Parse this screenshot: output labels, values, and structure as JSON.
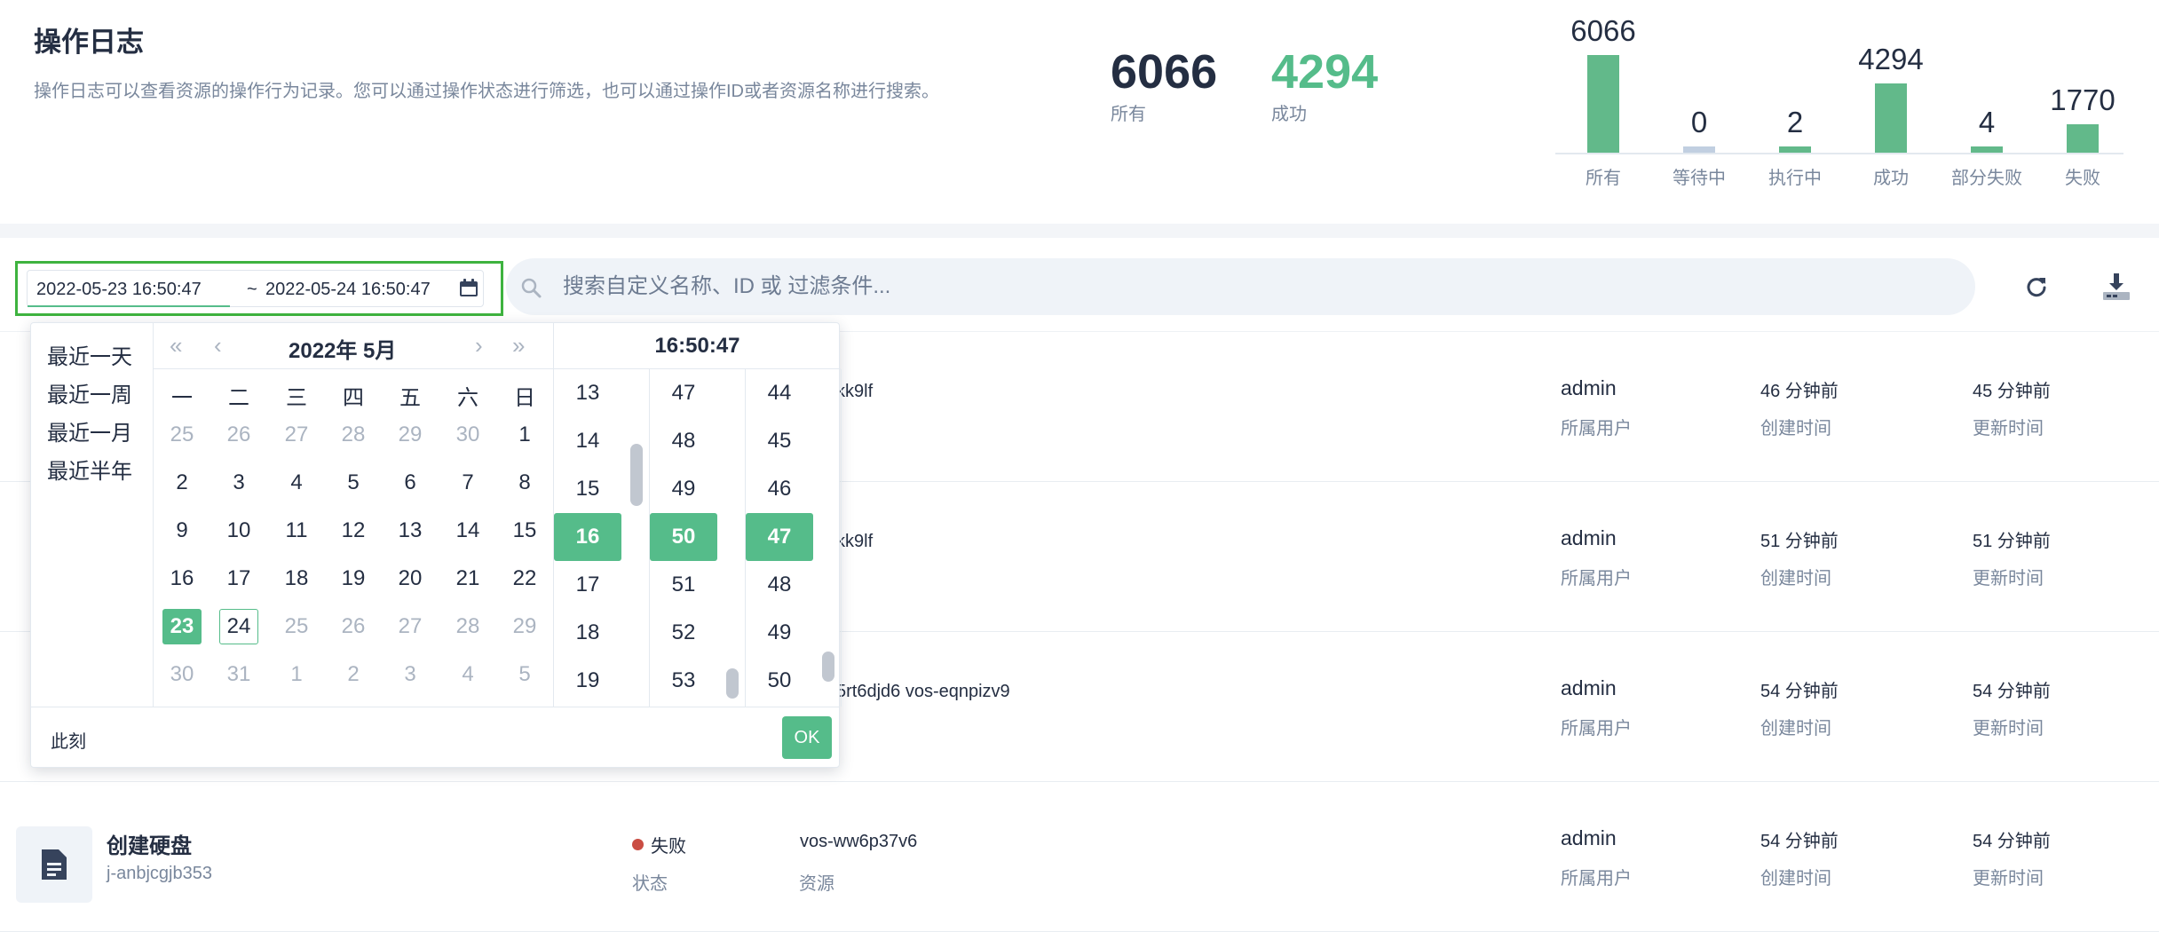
{
  "header": {
    "title": "操作日志",
    "description": "操作日志可以查看资源的操作行为记录。您可以通过操作状态进行筛选，也可以通过操作ID或者资源名称进行搜索。"
  },
  "stats": {
    "all": {
      "value": "6066",
      "label": "所有"
    },
    "success": {
      "value": "4294",
      "label": "成功"
    }
  },
  "chart_data": {
    "type": "bar",
    "categories": [
      "所有",
      "等待中",
      "执行中",
      "成功",
      "部分失败",
      "失败"
    ],
    "values": [
      6066,
      0,
      2,
      4294,
      4,
      1770
    ],
    "title": "",
    "xlabel": "",
    "ylabel": "",
    "colors": {
      "bar": "#62b98a",
      "zero_bar": "#c1cfe1"
    }
  },
  "toolbar": {
    "date_start": "2022-05-23 16:50:47",
    "date_sep": "~",
    "date_end": "2022-05-24 16:50:47",
    "search_placeholder": "搜索自定义名称、ID 或 过滤条件..."
  },
  "picker": {
    "shortcuts": [
      "最近一天",
      "最近一周",
      "最近一月",
      "最近半年"
    ],
    "title": "2022年  5月",
    "weekdays": [
      "一",
      "二",
      "三",
      "四",
      "五",
      "六",
      "日"
    ],
    "weeks": [
      [
        [
          "25",
          "o"
        ],
        [
          "26",
          "o"
        ],
        [
          "27",
          "o"
        ],
        [
          "28",
          "o"
        ],
        [
          "29",
          "o"
        ],
        [
          "30",
          "o"
        ],
        [
          "1",
          "c"
        ]
      ],
      [
        [
          "2",
          "c"
        ],
        [
          "3",
          "c"
        ],
        [
          "4",
          "c"
        ],
        [
          "5",
          "c"
        ],
        [
          "6",
          "c"
        ],
        [
          "7",
          "c"
        ],
        [
          "8",
          "c"
        ]
      ],
      [
        [
          "9",
          "c"
        ],
        [
          "10",
          "c"
        ],
        [
          "11",
          "c"
        ],
        [
          "12",
          "c"
        ],
        [
          "13",
          "c"
        ],
        [
          "14",
          "c"
        ],
        [
          "15",
          "c"
        ]
      ],
      [
        [
          "16",
          "c"
        ],
        [
          "17",
          "c"
        ],
        [
          "18",
          "c"
        ],
        [
          "19",
          "c"
        ],
        [
          "20",
          "c"
        ],
        [
          "21",
          "c"
        ],
        [
          "22",
          "c"
        ]
      ],
      [
        [
          "23",
          "s"
        ],
        [
          "24",
          "t"
        ],
        [
          "25",
          "o"
        ],
        [
          "26",
          "o"
        ],
        [
          "27",
          "o"
        ],
        [
          "28",
          "o"
        ],
        [
          "29",
          "o"
        ]
      ],
      [
        [
          "30",
          "o"
        ],
        [
          "31",
          "o"
        ],
        [
          "1",
          "o"
        ],
        [
          "2",
          "o"
        ],
        [
          "3",
          "o"
        ],
        [
          "4",
          "o"
        ],
        [
          "5",
          "o"
        ]
      ]
    ],
    "time": "16:50:47",
    "hours": [
      "13",
      "14",
      "15",
      "16",
      "17",
      "18",
      "19"
    ],
    "minutes": [
      "47",
      "48",
      "49",
      "50",
      "51",
      "52",
      "53"
    ],
    "seconds": [
      "44",
      "45",
      "46",
      "47",
      "48",
      "49",
      "50"
    ],
    "selected_index": 3,
    "now_label": "此刻",
    "ok_label": "OK"
  },
  "rows": [
    {
      "name": "",
      "sub": "",
      "status": "",
      "status_label": "",
      "resource": "kk9lf",
      "resource_label": "",
      "user": "admin",
      "user_label": "所属用户",
      "created": "46 分钟前",
      "created_label": "创建时间",
      "updated": "45 分钟前",
      "updated_label": "更新时间"
    },
    {
      "name": "",
      "sub": "",
      "status": "",
      "status_label": "",
      "resource": "kk9lf",
      "resource_label": "",
      "user": "admin",
      "user_label": "所属用户",
      "created": "51 分钟前",
      "created_label": "创建时间",
      "updated": "51 分钟前",
      "updated_label": "更新时间"
    },
    {
      "name": "",
      "sub": "",
      "status": "",
      "status_label": "",
      "resource": "5rt6djd6  vos-eqnpizv9",
      "resource_label": "",
      "user": "admin",
      "user_label": "所属用户",
      "created": "54 分钟前",
      "created_label": "创建时间",
      "updated": "54 分钟前",
      "updated_label": "更新时间"
    },
    {
      "name": "创建硬盘",
      "sub": "j-anbjcgjb353",
      "status": "失败",
      "status_label": "状态",
      "resource": "vos-ww6p37v6",
      "resource_label": "资源",
      "user": "admin",
      "user_label": "所属用户",
      "created": "54 分钟前",
      "created_label": "创建时间",
      "updated": "54 分钟前",
      "updated_label": "更新时间"
    }
  ]
}
